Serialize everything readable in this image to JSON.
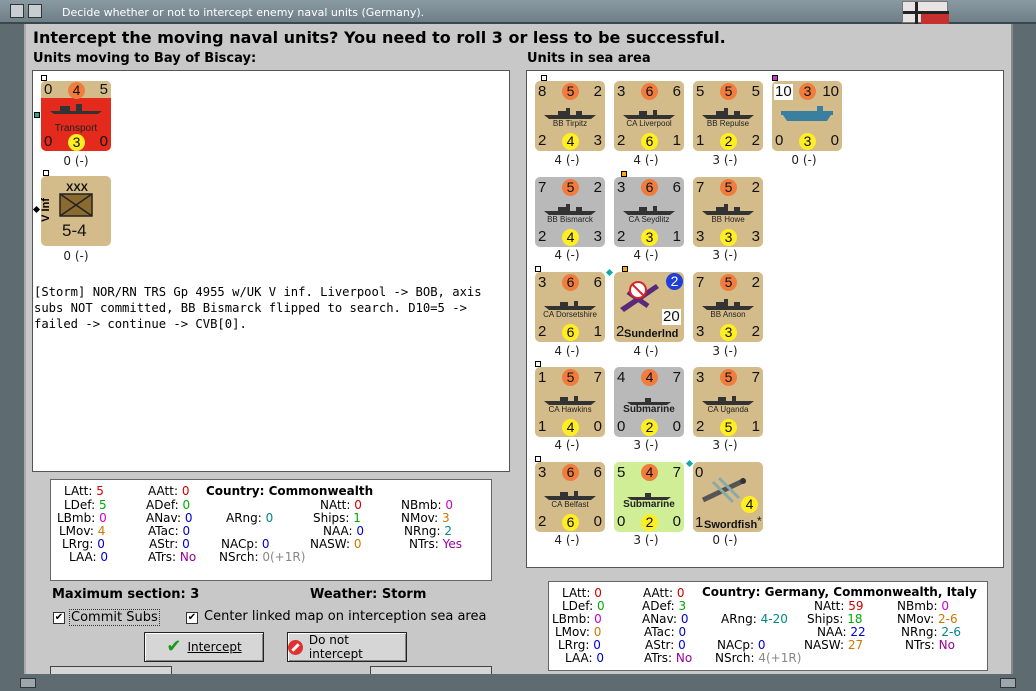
{
  "window": {
    "title": "Decide whether or not to intercept enemy naval units (Germany)."
  },
  "heading": "Intercept the moving naval units?  You need to roll 3 or less to be successful.",
  "left_label": "Units moving to Bay of Biscay:",
  "right_label": "Units in sea area",
  "moving": [
    {
      "name": "Transport",
      "tl": "0",
      "tc": "4",
      "tr": "5",
      "bl": "0",
      "bc": "3",
      "br": "0",
      "cap": "0 (-)"
    },
    {
      "name": "V Inf",
      "top": "XXX",
      "val": "5-4",
      "cap": "0 (-)"
    }
  ],
  "log": "[Storm]  NOR/RN TRS Gp 4955 w/UK V inf.  Liverpool -> BOB, axis subs NOT committed, BB Bismarck flipped to search.  D10=5 -> failed -> continue -> CVB[0].",
  "sea": [
    {
      "name": "BB Tirpitz",
      "tl": "8",
      "tc": "5",
      "tr": "2",
      "bl": "2",
      "bc": "4",
      "br": "3",
      "cap": "4 (-)"
    },
    {
      "name": "CA Liverpool",
      "tl": "3",
      "tc": "6",
      "tr": "6",
      "bl": "2",
      "bc": "6",
      "br": "1",
      "cap": "4 (-)"
    },
    {
      "name": "BB Repulse",
      "tl": "5",
      "tc": "5",
      "tr": "5",
      "bl": "1",
      "bc": "2",
      "br": "2",
      "cap": "3 (-)"
    },
    {
      "name": "",
      "tl": "10",
      "tc": "3",
      "tr": "10",
      "bl": "0",
      "bc": "3",
      "br": "0",
      "cap": "0 (-)"
    },
    {
      "name": "BB Bismarck",
      "tl": "7",
      "tc": "5",
      "tr": "2",
      "bl": "2",
      "bc": "4",
      "br": "3",
      "cap": "4 (-)"
    },
    {
      "name": "CA Seydlitz",
      "tl": "3",
      "tc": "6",
      "tr": "6",
      "bl": "2",
      "bc": "3",
      "br": "1",
      "cap": "4 (-)"
    },
    {
      "name": "BB Howe",
      "tl": "7",
      "tc": "5",
      "tr": "2",
      "bl": "3",
      "bc": "3",
      "br": "3",
      "cap": "3 (-)"
    },
    {
      "name": "CA Dorsetshire",
      "tl": "3",
      "tc": "6",
      "tr": "6",
      "bl": "2",
      "bc": "6",
      "br": "1",
      "cap": "4 (-)"
    },
    {
      "name": "Sunderlnd",
      "tr": "2",
      "br": "20",
      "bl": "2",
      "cap": "4 (-)"
    },
    {
      "name": "BB Anson",
      "tl": "7",
      "tc": "5",
      "tr": "2",
      "bl": "3",
      "bc": "3",
      "br": "2",
      "cap": "3 (-)"
    },
    {
      "name": "CA Hawkins",
      "tl": "1",
      "tc": "5",
      "tr": "7",
      "bl": "1",
      "bc": "4",
      "br": "0",
      "cap": "4 (-)"
    },
    {
      "name": "Submarine",
      "tl": "4",
      "tc": "4",
      "tr": "7",
      "bl": "0",
      "bc": "2",
      "br": "0",
      "cap": "3 (-)"
    },
    {
      "name": "CA Uganda",
      "tl": "3",
      "tc": "5",
      "tr": "7",
      "bl": "2",
      "bc": "5",
      "br": "1",
      "cap": "3 (-)"
    },
    {
      "name": "CA Belfast",
      "tl": "3",
      "tc": "6",
      "tr": "6",
      "bl": "2",
      "bc": "6",
      "br": "0",
      "cap": "4 (-)"
    },
    {
      "name": "Submarine",
      "tl": "5",
      "tc": "4",
      "tr": "7",
      "bl": "0",
      "bc": "2",
      "br": "0",
      "cap": "3 (-)"
    },
    {
      "name": "Swordfish",
      "tl": "0",
      "bl": "1",
      "bc": "4",
      "star": "*",
      "cap": "0 (-)"
    }
  ],
  "stats_left": {
    "labels": [
      "LAtt:",
      "LDef:",
      "LBmb:",
      "LMov:",
      "LRrg:",
      "LAA:",
      "AAtt:",
      "ADef:",
      "ANav:",
      "ATac:",
      "AStr:",
      "ATrs:",
      "ARng:",
      "NACp:",
      "NSrch:",
      "NAtt:",
      "Ships:",
      "NAA:",
      "NASW:",
      "NBmb:",
      "NMov:",
      "NRng:",
      "NTrs:"
    ],
    "values": [
      "5",
      "5",
      "0",
      "4",
      "0",
      "0",
      "0",
      "0",
      "0",
      "0",
      "0",
      "No",
      "0",
      "0",
      "0(+1R)",
      "0",
      "1",
      "0",
      "0",
      "0",
      "3",
      "2",
      "Yes"
    ],
    "country_label": "Country:",
    "country": "Commonwealth"
  },
  "stats_right": {
    "labels": [
      "LAtt:",
      "LDef:",
      "LBmb:",
      "LMov:",
      "LRrg:",
      "LAA:",
      "AAtt:",
      "ADef:",
      "ANav:",
      "ATac:",
      "AStr:",
      "ATrs:",
      "ARng:",
      "NACp:",
      "NSrch:",
      "NAtt:",
      "Ships:",
      "NAA:",
      "NASW:",
      "NBmb:",
      "NMov:",
      "NRng:",
      "NTrs:"
    ],
    "values": [
      "0",
      "0",
      "0",
      "0",
      "0",
      "0",
      "0",
      "3",
      "0",
      "0",
      "0",
      "No",
      "4-20",
      "0",
      "4(+1R)",
      "59",
      "18",
      "22",
      "27",
      "0",
      "2-6",
      "2-6",
      "No"
    ],
    "country_label": "Country:",
    "country": "Germany, Commonwealth, Italy"
  },
  "max_section_label": "Maximum section:",
  "max_section": "3",
  "weather_label": "Weather:",
  "weather": "Storm",
  "commit_subs": "Commit Subs",
  "center_map": "Center linked map on interception sea area",
  "intercept_btn": "Intercept",
  "no_intercept_btn": "Do not intercept"
}
